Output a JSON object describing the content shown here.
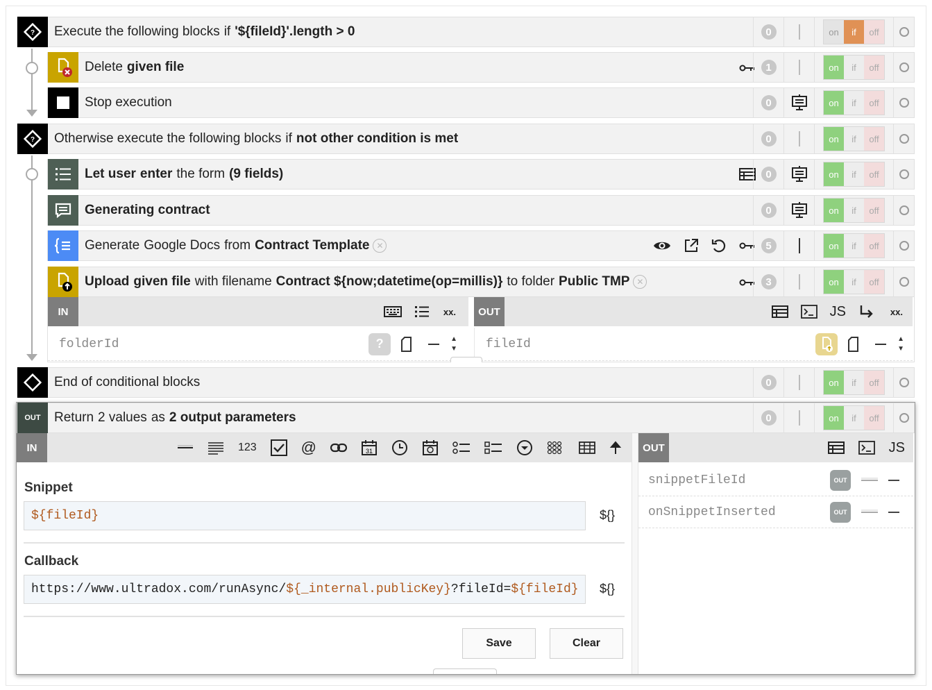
{
  "blocks": [
    {
      "type": "if",
      "parts": [
        {
          "t": "Execute the following blocks",
          "b": false
        },
        {
          "t": "if",
          "b": false
        },
        {
          "t": "'${fileId}'.length > 0",
          "b": true
        }
      ],
      "badge": "0",
      "toggle": "if"
    },
    {
      "type": "delete",
      "parts": [
        {
          "t": "Delete",
          "b": false
        },
        {
          "t": "given file",
          "b": true
        }
      ],
      "badge": "1",
      "toggle": "on"
    },
    {
      "type": "stop",
      "parts": [
        {
          "t": "Stop execution",
          "b": false
        }
      ],
      "badge": "0",
      "toggle": "on"
    },
    {
      "type": "else",
      "parts": [
        {
          "t": "Otherwise execute the following blocks",
          "b": false
        },
        {
          "t": "if",
          "b": false
        },
        {
          "t": "not other condition is met",
          "b": true
        }
      ],
      "badge": "0",
      "toggle": "on"
    },
    {
      "type": "form",
      "parts": [
        {
          "t": "Let user",
          "b": true
        },
        {
          "t": "enter",
          "b": true
        },
        {
          "t": "the form",
          "b": false
        },
        {
          "t": "(9 fields)",
          "b": true
        }
      ],
      "badge": "0",
      "toggle": "on"
    },
    {
      "type": "message",
      "parts": [
        {
          "t": "Generating contract",
          "b": true
        }
      ],
      "badge": "0",
      "toggle": "on"
    },
    {
      "type": "docs",
      "parts": [
        {
          "t": "Generate",
          "b": false
        },
        {
          "t": "Google Docs",
          "b": false
        },
        {
          "t": "from",
          "b": false
        },
        {
          "t": "Contract Template",
          "b": true
        }
      ],
      "badge": "5",
      "toggle": "on"
    },
    {
      "type": "upload",
      "parts": [
        {
          "t": "Upload",
          "b": true
        },
        {
          "t": "given file",
          "b": true
        },
        {
          "t": "with filename",
          "b": false
        },
        {
          "t": "Contract ${now;datetime(op=millis)}",
          "b": true
        },
        {
          "t": "to folder",
          "b": false
        },
        {
          "t": "Public TMP",
          "b": true
        }
      ],
      "badge": "3",
      "toggle": "on"
    },
    {
      "type": "end",
      "parts": [
        {
          "t": "End of conditional blocks",
          "b": false
        }
      ],
      "badge": "0",
      "toggle": "on"
    },
    {
      "type": "return",
      "parts": [
        {
          "t": "Return",
          "b": false
        },
        {
          "t": "2 values",
          "b": false
        },
        {
          "t": "as",
          "b": false
        },
        {
          "t": "2 output parameters",
          "b": true
        }
      ],
      "badge": "0",
      "toggle": "on"
    }
  ],
  "toggle_labels": {
    "on": "on",
    "if": "if",
    "off": "off"
  },
  "upload_panel": {
    "in_tag": "IN",
    "out_tag": "OUT",
    "in_param": "folderId",
    "out_param": "fileId",
    "in_extra": "xx.",
    "out_extra": "xx.",
    "js": "JS"
  },
  "return_panel": {
    "in_tag": "IN",
    "out_tag": "OUT",
    "out_chip": "OUT",
    "num_icon": "123",
    "js": "JS",
    "snippet_label": "Snippet",
    "snippet_value": "${fileId}",
    "callback_label": "Callback",
    "callback_parts": [
      {
        "t": "https://www.ultradox.com/runAsync/",
        "tpl": false
      },
      {
        "t": "${_internal.publicKey}",
        "tpl": true
      },
      {
        "t": "?fileId=",
        "tpl": false
      },
      {
        "t": "${fileId}",
        "tpl": true
      }
    ],
    "tpl_icon": "${}",
    "save": "Save",
    "clear": "Clear",
    "outputs": [
      "snippetFileId",
      "onSnippetInserted"
    ]
  },
  "colors": {
    "dark": "#000000",
    "yellow": "#c9a400",
    "form_green": "#4e5f55",
    "docs_blue": "#4c8bf5",
    "green_on": "#8fd17e",
    "orange_if": "#e09155",
    "template": "#b05a1e"
  }
}
